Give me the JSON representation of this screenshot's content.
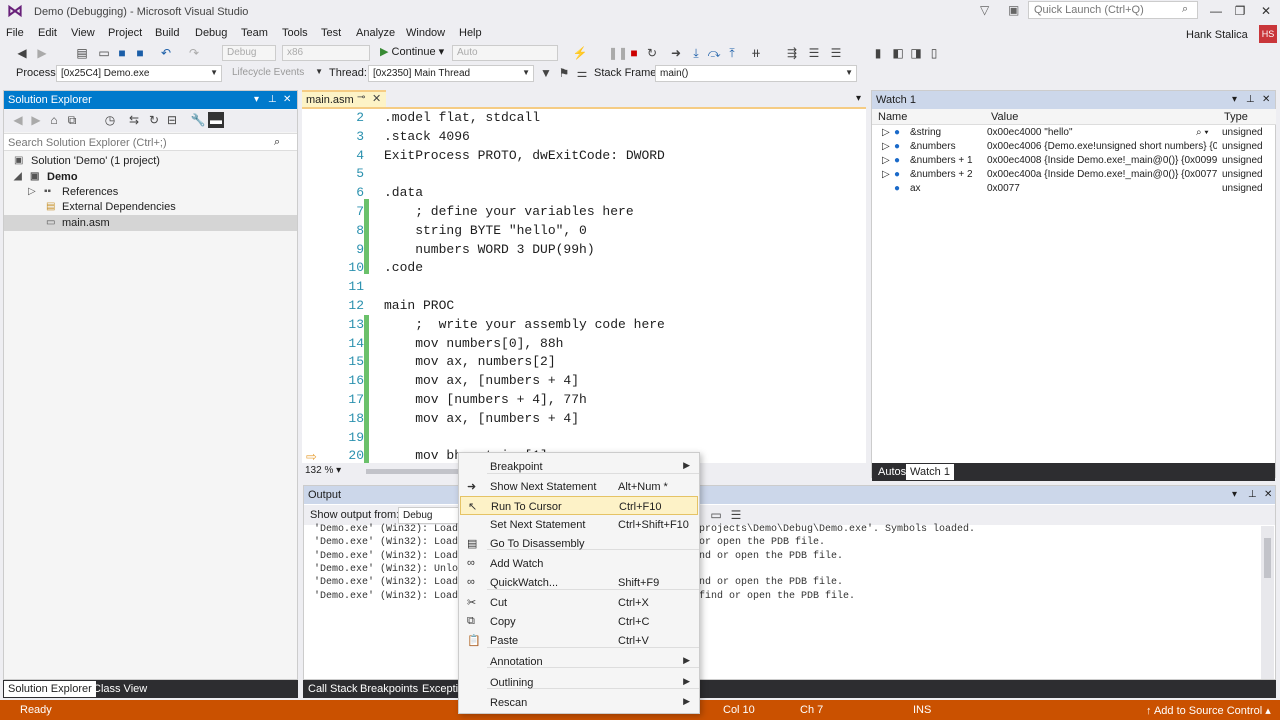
{
  "window": {
    "title": "Demo (Debugging) - Microsoft Visual Studio",
    "logo_icon": "visual-studio-logo",
    "quick_launch_placeholder": "Quick Launch (Ctrl+Q)",
    "user_name": "Hank Stalica",
    "user_initials": "HS"
  },
  "menu": [
    "File",
    "Edit",
    "View",
    "Project",
    "Build",
    "Debug",
    "Team",
    "Tools",
    "Test",
    "Analyze",
    "Window",
    "Help"
  ],
  "toolbar": {
    "config": "Debug",
    "platform": "x86",
    "continue_label": "Continue",
    "auto_label": "Auto",
    "process_label": "Process:",
    "process_value": "[0x25C4] Demo.exe",
    "lifecycle_label": "Lifecycle Events",
    "thread_label": "Thread:",
    "thread_value": "[0x2350] Main Thread",
    "stack_label": "Stack Frame:",
    "stack_value": "main()"
  },
  "solution_explorer": {
    "title": "Solution Explorer",
    "search_placeholder": "Search Solution Explorer (Ctrl+;)",
    "items": [
      {
        "label": "Solution 'Demo' (1 project)",
        "icon": "solution-icon"
      },
      {
        "label": "Demo",
        "icon": "project-icon"
      },
      {
        "label": "References",
        "icon": "references-icon"
      },
      {
        "label": "External Dependencies",
        "icon": "dependencies-icon"
      },
      {
        "label": "main.asm",
        "icon": "file-icon"
      }
    ],
    "tabs": [
      "Solution Explorer",
      "Class View"
    ]
  },
  "editor": {
    "tab_label": "main.asm",
    "zoom": "132 %",
    "lines": [
      {
        "n": "2",
        "code": ".model flat, stdcall"
      },
      {
        "n": "3",
        "code": ".stack 4096"
      },
      {
        "n": "4",
        "code": "ExitProcess PROTO, dwExitCode: DWORD"
      },
      {
        "n": "5",
        "code": ""
      },
      {
        "n": "6",
        "code": ".data"
      },
      {
        "n": "7",
        "code": "    ; define your variables here"
      },
      {
        "n": "8",
        "code": "    string BYTE \"hello\", 0"
      },
      {
        "n": "9",
        "code": "    numbers WORD 3 DUP(99h)"
      },
      {
        "n": "10",
        "code": ".code"
      },
      {
        "n": "11",
        "code": ""
      },
      {
        "n": "12",
        "code": "main PROC"
      },
      {
        "n": "13",
        "code": "    ;  write your assembly code here"
      },
      {
        "n": "14",
        "code": "    mov numbers[0], 88h"
      },
      {
        "n": "15",
        "code": "    mov ax, numbers[2]"
      },
      {
        "n": "16",
        "code": "    mov ax, [numbers + 4]"
      },
      {
        "n": "17",
        "code": "    mov [numbers + 4], 77h"
      },
      {
        "n": "18",
        "code": "    mov ax, [numbers + 4]"
      },
      {
        "n": "19",
        "code": ""
      },
      {
        "n": "20",
        "code": "    mov bh, string[1]"
      }
    ]
  },
  "watch": {
    "title": "Watch 1",
    "headers": [
      "Name",
      "Value",
      "Type"
    ],
    "rows": [
      {
        "name": "&string",
        "value": "0x00ec4000 \"hello\"",
        "type": "unsigned"
      },
      {
        "name": "&numbers",
        "value": "0x00ec4006 {Demo.exe!unsigned short numbers} {0x",
        "type": "unsigned"
      },
      {
        "name": "&numbers + 1",
        "value": "0x00ec4008 {Inside Demo.exe!_main@0()} {0x0099}",
        "type": "unsigned"
      },
      {
        "name": "&numbers + 2",
        "value": "0x00ec400a {Inside Demo.exe!_main@0()} {0x0077}",
        "type": "unsigned"
      },
      {
        "name": "ax",
        "value": "0x0077",
        "type": "unsigned"
      }
    ],
    "tabs": [
      "Autos",
      "Watch 1"
    ]
  },
  "output": {
    "title": "Output",
    "show_from_label": "Show output from:",
    "show_from_value": "Debug",
    "lines": [
      "'Demo.exe' (Win32): Loaded",
      "'Demo.exe' (Win32): Loaded",
      "'Demo.exe' (Win32): Loaded",
      "'Demo.exe' (Win32): Unloaded",
      "'Demo.exe' (Win32): Loaded",
      "'Demo.exe' (Win32): Loaded"
    ],
    "right_lines": [
      "projects\\Demo\\Debug\\Demo.exe'. Symbols loaded.",
      "or open the PDB file.",
      "nd or open the PDB file.",
      "",
      "nd or open the PDB file.",
      "find or open the PDB file."
    ],
    "tabs": [
      "Call Stack",
      "Breakpoints",
      "Exception"
    ]
  },
  "context_menu": [
    {
      "label": "Breakpoint",
      "key": "",
      "icon": "",
      "submenu": true
    },
    {
      "label": "Show Next Statement",
      "key": "Alt+Num *",
      "icon": "arrow-right-icon"
    },
    {
      "label": "Run To Cursor",
      "key": "Ctrl+F10",
      "icon": "cursor-icon",
      "highlight": true
    },
    {
      "label": "Set Next Statement",
      "key": "Ctrl+Shift+F10",
      "icon": ""
    },
    {
      "label": "Go To Disassembly",
      "key": "",
      "icon": "disassembly-icon"
    },
    {
      "label": "Add Watch",
      "key": "",
      "icon": "glasses-icon"
    },
    {
      "label": "QuickWatch...",
      "key": "Shift+F9",
      "icon": "glasses-icon"
    },
    {
      "label": "Cut",
      "key": "Ctrl+X",
      "icon": "scissors-icon"
    },
    {
      "label": "Copy",
      "key": "Ctrl+C",
      "icon": "copy-icon"
    },
    {
      "label": "Paste",
      "key": "Ctrl+V",
      "icon": "paste-icon"
    },
    {
      "label": "Annotation",
      "key": "",
      "icon": "",
      "submenu": true
    },
    {
      "label": "Outlining",
      "key": "",
      "icon": "",
      "submenu": true
    },
    {
      "label": "Rescan",
      "key": "",
      "icon": "",
      "submenu": true
    }
  ],
  "status": {
    "ready": "Ready",
    "col": "Col 10",
    "ch": "Ch 7",
    "ins": "INS",
    "source_control": "Add to Source Control",
    "accent_color": "#ca5100"
  }
}
